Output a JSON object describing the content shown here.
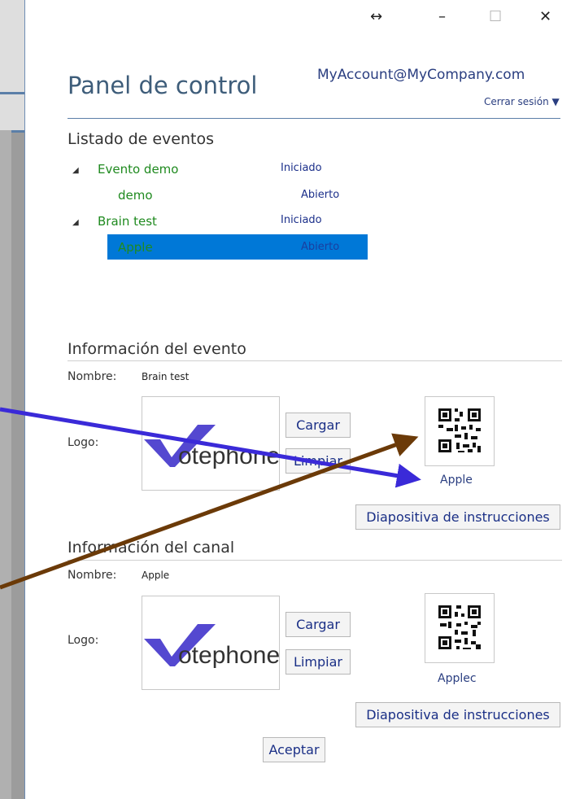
{
  "window": {
    "move_glyph": "↔",
    "minimize_glyph": "–",
    "maximize_glyph": "☐",
    "close_glyph": "✕"
  },
  "header": {
    "title": "Panel de control",
    "account": "MyAccount@MyCompany.com",
    "logout": "Cerrar sesión ▼"
  },
  "events": {
    "heading": "Listado de eventos",
    "groups": [
      {
        "name": "Evento demo",
        "status": "Iniciado",
        "children": [
          {
            "name": "demo",
            "status": "Abierto"
          }
        ]
      },
      {
        "name": "Brain test",
        "status": "Iniciado",
        "children": [
          {
            "name": "Apple",
            "status": "Abierto",
            "selected": true
          }
        ]
      }
    ]
  },
  "event_info": {
    "heading": "Información del evento",
    "name_label": "Nombre:",
    "name_value": "Brain test",
    "logo_label": "Logo:",
    "logo_text": "otephone",
    "load_button": "Cargar",
    "clear_button": "Limpiar",
    "qr_caption": "Apple",
    "slide_button": "Diapositiva de instrucciones"
  },
  "channel_info": {
    "heading": "Información del canal",
    "name_label": "Nombre:",
    "name_value": "Apple",
    "logo_label": "Logo:",
    "logo_text": "otephone",
    "load_button": "Cargar",
    "clear_button": "Limpiar",
    "qr_caption": "Applec",
    "slide_button": "Diapositiva de instrucciones"
  },
  "accept_button": "Aceptar",
  "colors": {
    "selection": "#0078d7",
    "arrow_blue": "#3a2ad8",
    "arrow_brown": "#6b3a08",
    "status_text": "#1b2f8a",
    "event_text": "#1f8a1f"
  }
}
